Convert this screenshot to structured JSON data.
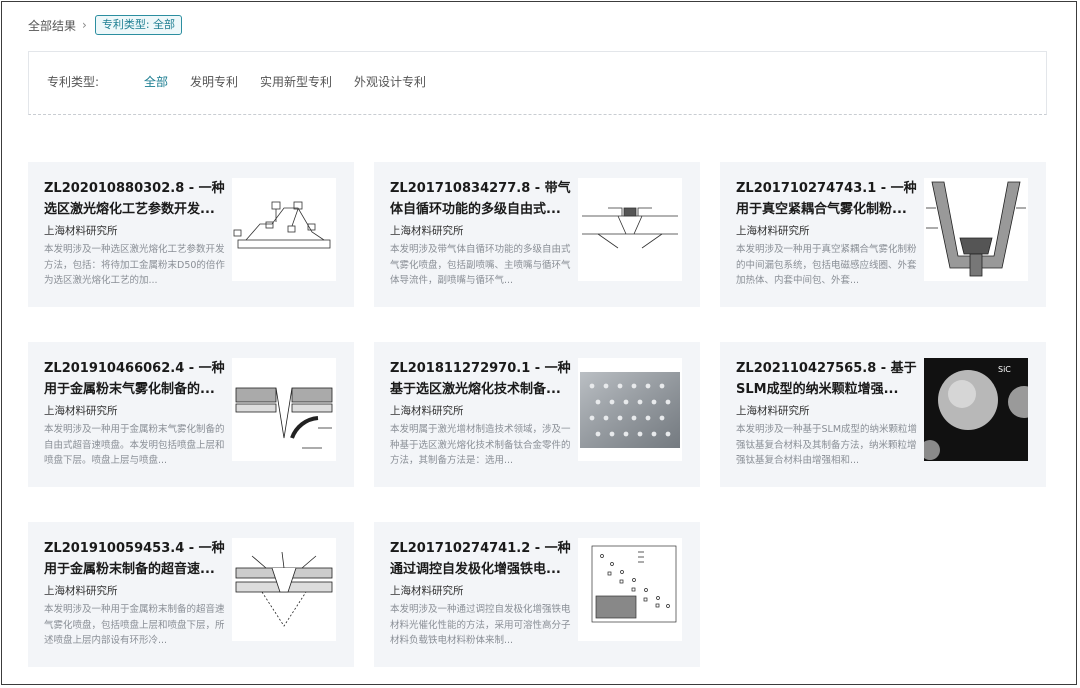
{
  "breadcrumb": {
    "root": "全部结果",
    "chip": "专利类型: 全部"
  },
  "filter": {
    "label": "专利类型:",
    "options": [
      "全部",
      "发明专利",
      "实用新型专利",
      "外观设计专利"
    ],
    "active_index": 0
  },
  "colors": {
    "accent": "#1a7c90",
    "card_bg": "#f3f5f8"
  },
  "cards": [
    {
      "title": "ZL202010880302.8 - 一种选区激光熔化工艺参数开发...",
      "org": "上海材料研究所",
      "desc": "本发明涉及一种选区激光熔化工艺参数开发方法，包括：将待加工金属粉末D50的倍作为选区激光熔化工艺的加...",
      "thumb": "schematic-drawing"
    },
    {
      "title": "ZL201710834277.8 - 带气体自循环功能的多级自由式...",
      "org": "上海材料研究所",
      "desc": "本发明涉及带气体自循环功能的多级自由式气雾化喷盘，包括副喷嘴、主喷嘴与循环气体导流件，副喷嘴与循环气...",
      "thumb": "nozzle-drawing"
    },
    {
      "title": "ZL201710274743.1 - 一种用于真空紧耦合气雾化制粉...",
      "org": "上海材料研究所",
      "desc": "本发明涉及一种用于真空紧耦合气雾化制粉的中间漏包系统，包括电磁感应线圈、外套加热体、内套中间包、外套...",
      "thumb": "crucible-drawing"
    },
    {
      "title": "ZL201910466062.4 - 一种用于金属粉末气雾化制备的...",
      "org": "上海材料研究所",
      "desc": "本发明涉及一种用于金属粉末气雾化制备的自由式超音速喷盘。本发明包括喷盘上层和喷盘下层。喷盘上层与喷盘...",
      "thumb": "spray-disk-drawing"
    },
    {
      "title": "ZL201811272970.1 - 一种基于选区激光熔化技术制备...",
      "org": "上海材料研究所",
      "desc": "本发明属于激光增材制造技术领域，涉及一种基于选区激光熔化技术制备钛合金零件的方法，其制备方法是：选用...",
      "thumb": "lattice-photo"
    },
    {
      "title": "ZL202110427565.8 - 基于SLM成型的纳米颗粒增强...",
      "org": "上海材料研究所",
      "desc": "本发明涉及一种基于SLM成型的纳米颗粒增强钛基复合材料及其制备方法，纳米颗粒增强钛基复合材料由增强相和...",
      "thumb": "sem-photo",
      "thumb_label": "SiC"
    },
    {
      "title": "ZL201910059453.4 - 一种用于金属粉末制备的超音速...",
      "org": "上海材料研究所",
      "desc": "本发明涉及一种用于金属粉末制备的超音速气雾化喷盘，包括喷盘上层和喷盘下层，所述喷盘上层内部设有环形冷...",
      "thumb": "supersonic-nozzle-drawing"
    },
    {
      "title": "ZL201710274741.2 - 一种通过调控自发极化增强铁电...",
      "org": "上海材料研究所",
      "desc": "本发明涉及一种通过调控自发极化增强铁电材料光催化性能的方法，采用可溶性高分子材料负载铁电材料粉体来制...",
      "thumb": "scatter-plot"
    }
  ]
}
